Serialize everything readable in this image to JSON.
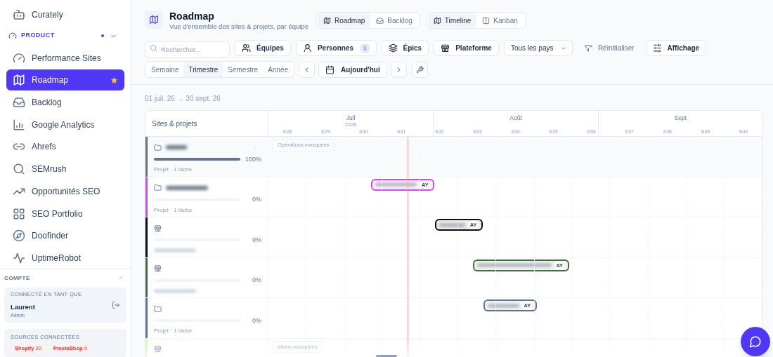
{
  "sidebar": {
    "top_item": {
      "label": "Curately"
    },
    "section": {
      "label": "PRODUCT",
      "expanded": true
    },
    "items": [
      {
        "label": "Performance Sites",
        "selected": false,
        "starred": false
      },
      {
        "label": "Roadmap",
        "selected": true,
        "starred": true
      },
      {
        "label": "Backlog",
        "selected": false,
        "starred": false
      },
      {
        "label": "Google Analytics",
        "selected": false,
        "starred": false
      },
      {
        "label": "Ahrefs",
        "selected": false,
        "starred": false
      },
      {
        "label": "SEMrush",
        "selected": false,
        "starred": false
      },
      {
        "label": "Opportunités SEO",
        "selected": false,
        "starred": false
      },
      {
        "label": "SEO Portfolio",
        "selected": false,
        "starred": false
      },
      {
        "label": "Doofinder",
        "selected": false,
        "starred": false
      },
      {
        "label": "UptimeRobot",
        "selected": false,
        "starred": false
      }
    ],
    "account": {
      "heading": "COMPTE",
      "expanded": true,
      "connected_label": "CONNECTÉ EN TANT QUE",
      "user": "Laurent",
      "role": "Admin"
    },
    "sources": {
      "heading": "SOURCES CONNECTÉES",
      "items": [
        {
          "name": "Shopify",
          "count": "20"
        },
        {
          "name": "PrestaShop",
          "count": "9"
        }
      ]
    }
  },
  "header": {
    "title": "Roadmap",
    "subtitle": "Vue d'ensemble des sites & projets, par équipe",
    "view_switch": [
      {
        "label": "Roadmap",
        "selected": true
      },
      {
        "label": "Backlog",
        "selected": false
      }
    ],
    "layout_switch": [
      {
        "label": "Timeline",
        "selected": true
      },
      {
        "label": "Kanban",
        "selected": false
      }
    ]
  },
  "toolbar": {
    "search": {
      "placeholder": "Rechercher..."
    },
    "filters": [
      {
        "kind": "button",
        "label": "Équipes"
      },
      {
        "kind": "button",
        "label": "Personnes",
        "badge": "1"
      },
      {
        "kind": "button",
        "label": "Épics"
      },
      {
        "kind": "button",
        "label": "Plateforme"
      },
      {
        "kind": "dropdown",
        "label": "Tous les pays"
      },
      {
        "kind": "reset",
        "label": "Réinitialiser"
      },
      {
        "kind": "button",
        "label": "Affichage"
      }
    ],
    "periods": [
      {
        "label": "Semaine",
        "selected": false
      },
      {
        "label": "Trimestre",
        "selected": true
      },
      {
        "label": "Semestre",
        "selected": false
      },
      {
        "label": "Année",
        "selected": false
      }
    ],
    "today": "Aujourd'hui"
  },
  "date_range": "01 juil. 26 → 30 sept. 26",
  "gantt": {
    "column_header": "Sites & projets",
    "months": [
      {
        "label": "Juil",
        "year": "2026"
      },
      {
        "label": "Août"
      },
      {
        "label": "Sept"
      }
    ],
    "weeks": [
      "S28",
      "S29",
      "S30",
      "S31",
      "S32",
      "S33",
      "S34",
      "S35",
      "S36",
      "S37",
      "S38",
      "S39",
      "S40"
    ],
    "rows": [
      {
        "kind": "project",
        "color": "#64748b",
        "level": 1,
        "percent": "100%",
        "subtitle": "Projet · 1 tâche",
        "expandable": true,
        "masked": "Opérations masquées"
      },
      {
        "kind": "project",
        "color": "#d946ef",
        "level": 0,
        "percent": "0%",
        "subtitle": "Projet · 1 tâche",
        "expandable": false,
        "bar": {
          "initials": "AY"
        }
      },
      {
        "kind": "store",
        "color": "#0f0f0f",
        "level": 0,
        "percent": "0%",
        "expandable": false,
        "bar": {
          "initials": "AY"
        }
      },
      {
        "kind": "store",
        "color": "#3f6f45",
        "level": 0,
        "percent": "0%",
        "expandable": false,
        "bar": {
          "initials": "AY"
        }
      },
      {
        "kind": "project",
        "color": "#64748b",
        "level": 0,
        "percent": "0%",
        "subtitle": "Projet · 1 tâche",
        "expandable": false,
        "bar": {
          "initials": "AY"
        }
      },
      {
        "kind": "store",
        "color": "#d9f99d",
        "expandable": false,
        "masked": "ations masquées"
      }
    ]
  }
}
